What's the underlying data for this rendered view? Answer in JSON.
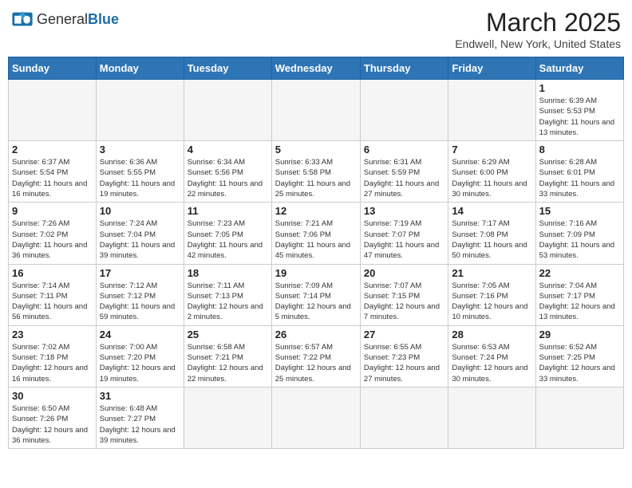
{
  "header": {
    "logo_general": "General",
    "logo_blue": "Blue",
    "month_title": "March 2025",
    "location": "Endwell, New York, United States"
  },
  "weekdays": [
    "Sunday",
    "Monday",
    "Tuesday",
    "Wednesday",
    "Thursday",
    "Friday",
    "Saturday"
  ],
  "weeks": [
    [
      {
        "day": "",
        "info": ""
      },
      {
        "day": "",
        "info": ""
      },
      {
        "day": "",
        "info": ""
      },
      {
        "day": "",
        "info": ""
      },
      {
        "day": "",
        "info": ""
      },
      {
        "day": "",
        "info": ""
      },
      {
        "day": "1",
        "info": "Sunrise: 6:39 AM\nSunset: 5:53 PM\nDaylight: 11 hours and 13 minutes."
      }
    ],
    [
      {
        "day": "2",
        "info": "Sunrise: 6:37 AM\nSunset: 5:54 PM\nDaylight: 11 hours and 16 minutes."
      },
      {
        "day": "3",
        "info": "Sunrise: 6:36 AM\nSunset: 5:55 PM\nDaylight: 11 hours and 19 minutes."
      },
      {
        "day": "4",
        "info": "Sunrise: 6:34 AM\nSunset: 5:56 PM\nDaylight: 11 hours and 22 minutes."
      },
      {
        "day": "5",
        "info": "Sunrise: 6:33 AM\nSunset: 5:58 PM\nDaylight: 11 hours and 25 minutes."
      },
      {
        "day": "6",
        "info": "Sunrise: 6:31 AM\nSunset: 5:59 PM\nDaylight: 11 hours and 27 minutes."
      },
      {
        "day": "7",
        "info": "Sunrise: 6:29 AM\nSunset: 6:00 PM\nDaylight: 11 hours and 30 minutes."
      },
      {
        "day": "8",
        "info": "Sunrise: 6:28 AM\nSunset: 6:01 PM\nDaylight: 11 hours and 33 minutes."
      }
    ],
    [
      {
        "day": "9",
        "info": "Sunrise: 7:26 AM\nSunset: 7:02 PM\nDaylight: 11 hours and 36 minutes."
      },
      {
        "day": "10",
        "info": "Sunrise: 7:24 AM\nSunset: 7:04 PM\nDaylight: 11 hours and 39 minutes."
      },
      {
        "day": "11",
        "info": "Sunrise: 7:23 AM\nSunset: 7:05 PM\nDaylight: 11 hours and 42 minutes."
      },
      {
        "day": "12",
        "info": "Sunrise: 7:21 AM\nSunset: 7:06 PM\nDaylight: 11 hours and 45 minutes."
      },
      {
        "day": "13",
        "info": "Sunrise: 7:19 AM\nSunset: 7:07 PM\nDaylight: 11 hours and 47 minutes."
      },
      {
        "day": "14",
        "info": "Sunrise: 7:17 AM\nSunset: 7:08 PM\nDaylight: 11 hours and 50 minutes."
      },
      {
        "day": "15",
        "info": "Sunrise: 7:16 AM\nSunset: 7:09 PM\nDaylight: 11 hours and 53 minutes."
      }
    ],
    [
      {
        "day": "16",
        "info": "Sunrise: 7:14 AM\nSunset: 7:11 PM\nDaylight: 11 hours and 56 minutes."
      },
      {
        "day": "17",
        "info": "Sunrise: 7:12 AM\nSunset: 7:12 PM\nDaylight: 11 hours and 59 minutes."
      },
      {
        "day": "18",
        "info": "Sunrise: 7:11 AM\nSunset: 7:13 PM\nDaylight: 12 hours and 2 minutes."
      },
      {
        "day": "19",
        "info": "Sunrise: 7:09 AM\nSunset: 7:14 PM\nDaylight: 12 hours and 5 minutes."
      },
      {
        "day": "20",
        "info": "Sunrise: 7:07 AM\nSunset: 7:15 PM\nDaylight: 12 hours and 7 minutes."
      },
      {
        "day": "21",
        "info": "Sunrise: 7:05 AM\nSunset: 7:16 PM\nDaylight: 12 hours and 10 minutes."
      },
      {
        "day": "22",
        "info": "Sunrise: 7:04 AM\nSunset: 7:17 PM\nDaylight: 12 hours and 13 minutes."
      }
    ],
    [
      {
        "day": "23",
        "info": "Sunrise: 7:02 AM\nSunset: 7:18 PM\nDaylight: 12 hours and 16 minutes."
      },
      {
        "day": "24",
        "info": "Sunrise: 7:00 AM\nSunset: 7:20 PM\nDaylight: 12 hours and 19 minutes."
      },
      {
        "day": "25",
        "info": "Sunrise: 6:58 AM\nSunset: 7:21 PM\nDaylight: 12 hours and 22 minutes."
      },
      {
        "day": "26",
        "info": "Sunrise: 6:57 AM\nSunset: 7:22 PM\nDaylight: 12 hours and 25 minutes."
      },
      {
        "day": "27",
        "info": "Sunrise: 6:55 AM\nSunset: 7:23 PM\nDaylight: 12 hours and 27 minutes."
      },
      {
        "day": "28",
        "info": "Sunrise: 6:53 AM\nSunset: 7:24 PM\nDaylight: 12 hours and 30 minutes."
      },
      {
        "day": "29",
        "info": "Sunrise: 6:52 AM\nSunset: 7:25 PM\nDaylight: 12 hours and 33 minutes."
      }
    ],
    [
      {
        "day": "30",
        "info": "Sunrise: 6:50 AM\nSunset: 7:26 PM\nDaylight: 12 hours and 36 minutes."
      },
      {
        "day": "31",
        "info": "Sunrise: 6:48 AM\nSunset: 7:27 PM\nDaylight: 12 hours and 39 minutes."
      },
      {
        "day": "",
        "info": ""
      },
      {
        "day": "",
        "info": ""
      },
      {
        "day": "",
        "info": ""
      },
      {
        "day": "",
        "info": ""
      },
      {
        "day": "",
        "info": ""
      }
    ]
  ]
}
